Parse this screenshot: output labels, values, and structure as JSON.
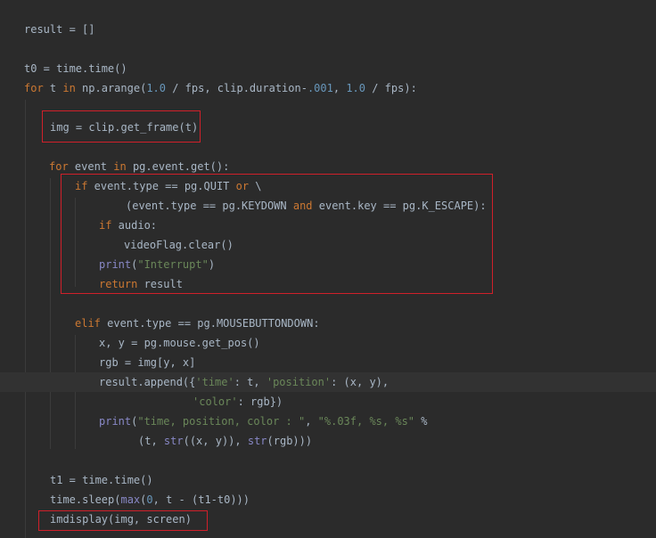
{
  "colors": {
    "background": "#2b2b2b",
    "text": "#a9b7c6",
    "keyword": "#cc7832",
    "number": "#6897bb",
    "string": "#6a8759",
    "builtin": "#8888c6",
    "highlight_box": "#d0202a",
    "current_line": "#323232"
  },
  "code": {
    "lines": [
      {
        "tokens": [
          {
            "t": "result = []",
            "k": "plain"
          }
        ]
      },
      {
        "tokens": []
      },
      {
        "tokens": [
          {
            "t": "t0 = time.time()",
            "k": "plain"
          }
        ]
      },
      {
        "tokens": [
          {
            "t": "for",
            "k": "kw"
          },
          {
            "t": " t ",
            "k": "plain"
          },
          {
            "t": "in",
            "k": "kw"
          },
          {
            "t": " np.arange(",
            "k": "plain"
          },
          {
            "t": "1.0",
            "k": "num"
          },
          {
            "t": " / fps, clip.duration-",
            "k": "plain"
          },
          {
            "t": ".001",
            "k": "num"
          },
          {
            "t": ", ",
            "k": "plain"
          },
          {
            "t": "1.0",
            "k": "num"
          },
          {
            "t": " / fps):",
            "k": "plain"
          }
        ]
      },
      {
        "tokens": []
      },
      {
        "tokens": [
          {
            "t": "img = clip.get_frame(t)",
            "k": "plain"
          }
        ]
      },
      {
        "tokens": []
      },
      {
        "tokens": [
          {
            "t": "for",
            "k": "kw"
          },
          {
            "t": " event ",
            "k": "plain"
          },
          {
            "t": "in",
            "k": "kw"
          },
          {
            "t": " pg.event.get():",
            "k": "plain"
          }
        ]
      },
      {
        "tokens": [
          {
            "t": "if",
            "k": "kw"
          },
          {
            "t": " event.type == pg.QUIT ",
            "k": "plain"
          },
          {
            "t": "or",
            "k": "kw"
          },
          {
            "t": " \\",
            "k": "plain"
          }
        ]
      },
      {
        "tokens": [
          {
            "t": "(event.type == pg.KEYDOWN ",
            "k": "plain"
          },
          {
            "t": "and",
            "k": "kw"
          },
          {
            "t": " event.key == pg.K_ESCAPE):",
            "k": "plain"
          }
        ]
      },
      {
        "tokens": [
          {
            "t": "if",
            "k": "kw"
          },
          {
            "t": " audio:",
            "k": "plain"
          }
        ]
      },
      {
        "tokens": [
          {
            "t": "videoFlag.clear()",
            "k": "plain"
          }
        ]
      },
      {
        "tokens": [
          {
            "t": "print",
            "k": "bi"
          },
          {
            "t": "(",
            "k": "plain"
          },
          {
            "t": "\"Interrupt\"",
            "k": "str"
          },
          {
            "t": ")",
            "k": "plain"
          }
        ]
      },
      {
        "tokens": [
          {
            "t": "return",
            "k": "kw"
          },
          {
            "t": " result",
            "k": "plain"
          }
        ]
      },
      {
        "tokens": []
      },
      {
        "tokens": [
          {
            "t": "elif",
            "k": "kw"
          },
          {
            "t": " event.type == pg.MOUSEBUTTONDOWN:",
            "k": "plain"
          }
        ]
      },
      {
        "tokens": [
          {
            "t": "x, y = pg.mouse.get_pos()",
            "k": "plain"
          }
        ]
      },
      {
        "tokens": [
          {
            "t": "rgb = img[y, x]",
            "k": "plain"
          }
        ]
      },
      {
        "tokens": [
          {
            "t": "result.append({",
            "k": "plain"
          },
          {
            "t": "'time'",
            "k": "str"
          },
          {
            "t": ": t, ",
            "k": "plain"
          },
          {
            "t": "'position'",
            "k": "str"
          },
          {
            "t": ": (x, y),",
            "k": "plain"
          }
        ]
      },
      {
        "tokens": [
          {
            "t": "'color'",
            "k": "str"
          },
          {
            "t": ": rgb})",
            "k": "plain"
          }
        ]
      },
      {
        "tokens": [
          {
            "t": "print",
            "k": "bi"
          },
          {
            "t": "(",
            "k": "plain"
          },
          {
            "t": "\"time, position, color : \"",
            "k": "str"
          },
          {
            "t": ", ",
            "k": "plain"
          },
          {
            "t": "\"%.03f, %s, %s\"",
            "k": "str"
          },
          {
            "t": " %",
            "k": "plain"
          }
        ]
      },
      {
        "tokens": [
          {
            "t": "(t, ",
            "k": "plain"
          },
          {
            "t": "str",
            "k": "bi"
          },
          {
            "t": "((x, y)), ",
            "k": "plain"
          },
          {
            "t": "str",
            "k": "bi"
          },
          {
            "t": "(rgb)))",
            "k": "plain"
          }
        ]
      },
      {
        "tokens": []
      },
      {
        "tokens": [
          {
            "t": "t1 = time.time()",
            "k": "plain"
          }
        ]
      },
      {
        "tokens": [
          {
            "t": "time.sleep(",
            "k": "plain"
          },
          {
            "t": "max",
            "k": "bi"
          },
          {
            "t": "(",
            "k": "plain"
          },
          {
            "t": "0",
            "k": "num"
          },
          {
            "t": ", t - (t1-t0)))",
            "k": "plain"
          }
        ]
      },
      {
        "tokens": [
          {
            "t": "imdisplay(img, screen)",
            "k": "plain"
          }
        ]
      }
    ]
  }
}
